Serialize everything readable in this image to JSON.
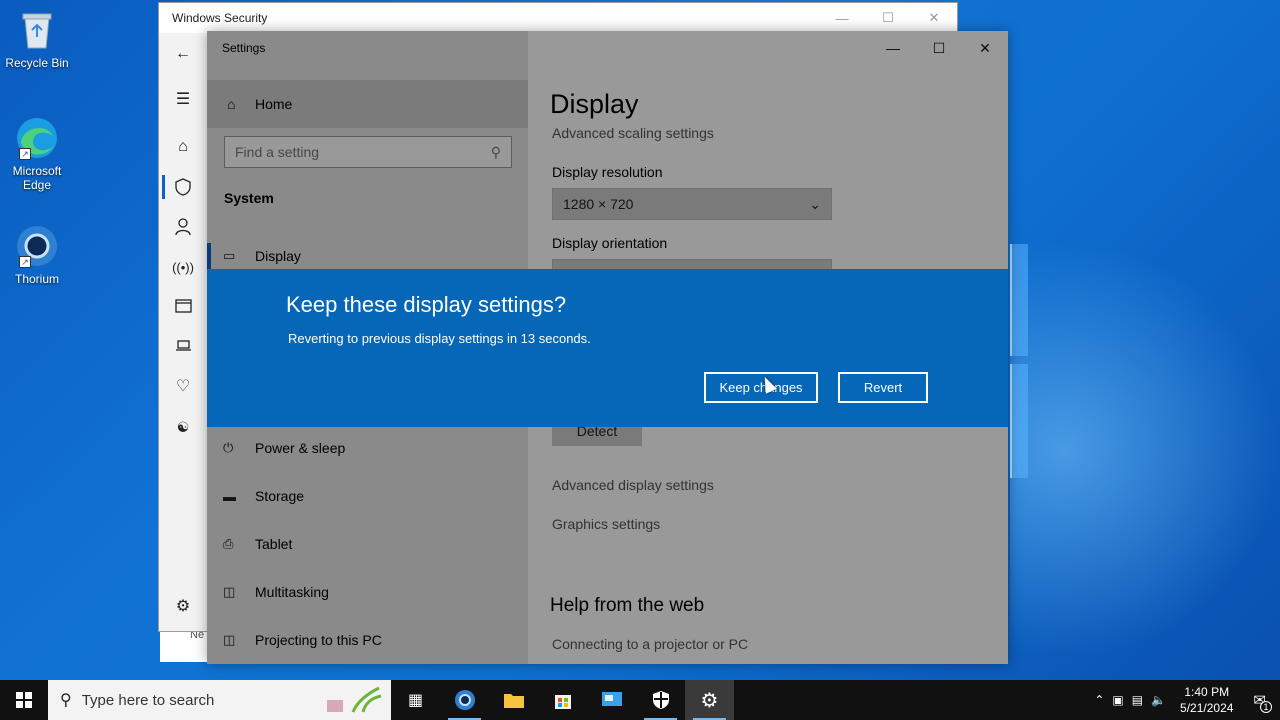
{
  "desktop": {
    "icons": [
      {
        "label": "Recycle Bin",
        "icon": "recycle-bin-icon"
      },
      {
        "label": "Microsoft Edge",
        "icon": "edge-icon"
      },
      {
        "label": "Thorium",
        "icon": "thorium-icon"
      }
    ]
  },
  "security_window": {
    "title": "Windows Security",
    "rail": [
      "back-arrow-icon",
      "hamburger-icon",
      "home-icon",
      "shield-icon",
      "person-icon",
      "wireless-icon",
      "app-browser-icon",
      "laptop-icon",
      "heart-icon",
      "family-icon",
      "gear-icon"
    ],
    "bottom_fragment": "Ne"
  },
  "settings_window": {
    "title": "Settings",
    "home_label": "Home",
    "search_placeholder": "Find a setting",
    "section_header": "System",
    "nav": [
      {
        "label": "Display",
        "icon": "monitor-icon",
        "selected": true
      },
      {
        "label": "Power & sleep",
        "icon": "power-icon"
      },
      {
        "label": "Storage",
        "icon": "storage-icon"
      },
      {
        "label": "Tablet",
        "icon": "tablet-icon"
      },
      {
        "label": "Multitasking",
        "icon": "multitasking-icon"
      },
      {
        "label": "Projecting to this PC",
        "icon": "projecting-icon"
      }
    ],
    "page_title": "Display",
    "scaling_link": "Advanced scaling settings",
    "resolution_label": "Display resolution",
    "resolution_value": "1280 × 720",
    "orientation_label": "Display orientation",
    "detect_button": "Detect",
    "advanced_display_link": "Advanced display settings",
    "graphics_link": "Graphics settings",
    "help_heading": "Help from the web",
    "help_link": "Connecting to a projector or PC"
  },
  "dialog": {
    "title": "Keep these display settings?",
    "message": "Reverting to previous display settings in 13 seconds.",
    "keep_button": "Keep changes",
    "revert_button": "Revert"
  },
  "taskbar": {
    "search_placeholder": "Type here to search",
    "apps": [
      "task-view-icon",
      "thorium-icon",
      "file-explorer-icon",
      "store-icon",
      "remote-desktop-icon",
      "windows-security-icon",
      "settings-icon"
    ],
    "time": "1:40 PM",
    "date": "5/21/2024",
    "notification_count": "1"
  }
}
